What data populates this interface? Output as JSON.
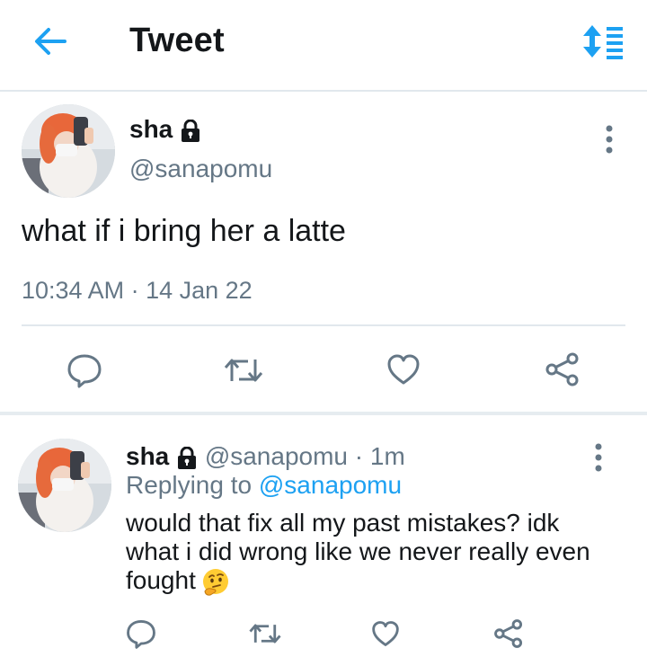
{
  "header": {
    "title": "Tweet",
    "back_icon": "arrow-left-icon",
    "sort_icon": "sort-list-icon"
  },
  "main_tweet": {
    "author_name": "sha",
    "handle": "@sanapomu",
    "text": "what if i bring her a latte",
    "timestamp": "10:34 AM · 14 Jan 22",
    "actions": [
      "reply-icon",
      "retweet-icon",
      "like-icon",
      "share-icon"
    ]
  },
  "reply_tweet": {
    "author_name": "sha",
    "handle_time": "@sanapomu · 1m",
    "replying_prefix": "Replying to",
    "replying_to": "@sanapomu",
    "text": "would that fix all my past mistakes? idk what i did wrong like we never really even fought",
    "emoji": "thinking-face-emoji",
    "actions": [
      "reply-icon",
      "retweet-icon",
      "like-icon",
      "share-icon"
    ]
  },
  "colors": {
    "accent": "#1da1f2",
    "text_primary": "#14171a",
    "text_secondary": "#657786",
    "divider": "#e1e8ed"
  }
}
